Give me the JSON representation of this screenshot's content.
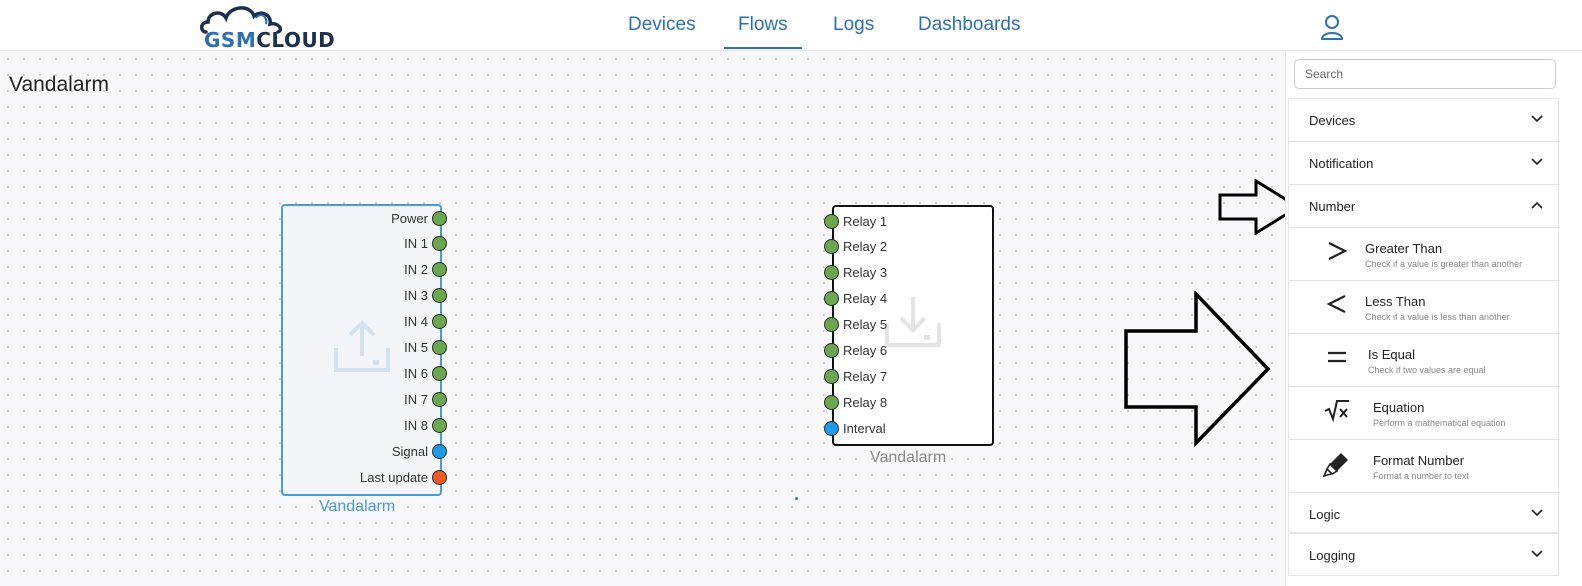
{
  "header": {
    "logo": {
      "part1": "GSM",
      "part2": "CLOUD"
    },
    "nav": [
      {
        "label": "Devices",
        "active": false
      },
      {
        "label": "Flows",
        "active": true
      },
      {
        "label": "Logs",
        "active": false
      },
      {
        "label": "Dashboards",
        "active": false
      }
    ],
    "user_icon": "user-icon"
  },
  "canvas": {
    "flow_title": "Vandalarm",
    "source_node": {
      "label": "Vandalarm",
      "icon": "upload-icon",
      "ports": [
        {
          "label": "Power",
          "color": "green"
        },
        {
          "label": "IN 1",
          "color": "green"
        },
        {
          "label": "IN 2",
          "color": "green"
        },
        {
          "label": "IN 3",
          "color": "green"
        },
        {
          "label": "IN 4",
          "color": "green"
        },
        {
          "label": "IN 5",
          "color": "green"
        },
        {
          "label": "IN 6",
          "color": "green"
        },
        {
          "label": "IN 7",
          "color": "green"
        },
        {
          "label": "IN 8",
          "color": "green"
        },
        {
          "label": "Signal",
          "color": "blue"
        },
        {
          "label": "Last update",
          "color": "orange"
        }
      ]
    },
    "target_node": {
      "label": "Vandalarm",
      "icon": "download-icon",
      "ports": [
        {
          "label": "Relay 1",
          "color": "green"
        },
        {
          "label": "Relay 2",
          "color": "green"
        },
        {
          "label": "Relay 3",
          "color": "green"
        },
        {
          "label": "Relay 4",
          "color": "green"
        },
        {
          "label": "Relay 5",
          "color": "green"
        },
        {
          "label": "Relay 6",
          "color": "green"
        },
        {
          "label": "Relay 7",
          "color": "green"
        },
        {
          "label": "Relay 8",
          "color": "green"
        },
        {
          "label": "Interval",
          "color": "blue"
        }
      ]
    }
  },
  "panel": {
    "search_placeholder": "Search",
    "sections": [
      {
        "label": "Devices",
        "expanded": false
      },
      {
        "label": "Notification",
        "expanded": false
      },
      {
        "label": "Number",
        "expanded": true
      },
      {
        "label": "Logic",
        "expanded": false
      },
      {
        "label": "Logging",
        "expanded": false
      }
    ],
    "number_items": [
      {
        "title": "Greater Than",
        "desc": "Check if a value is greater than another",
        "icon": "greater-than-icon"
      },
      {
        "title": "Less Than",
        "desc": "Check if a value is less than another",
        "icon": "less-than-icon"
      },
      {
        "title": "Is Equal",
        "desc": "Check if two values are equal",
        "icon": "equals-icon"
      },
      {
        "title": "Equation",
        "desc": "Perform a mathematical equation",
        "icon": "square-root-icon"
      },
      {
        "title": "Format Number",
        "desc": "Format a number to text",
        "icon": "marker-icon"
      }
    ]
  },
  "colors": {
    "accent": "#2f6fb3",
    "node_border": "#4a9bd1",
    "port_green": "#6aa84f",
    "port_blue": "#1e9be9",
    "port_orange": "#f15a22"
  }
}
